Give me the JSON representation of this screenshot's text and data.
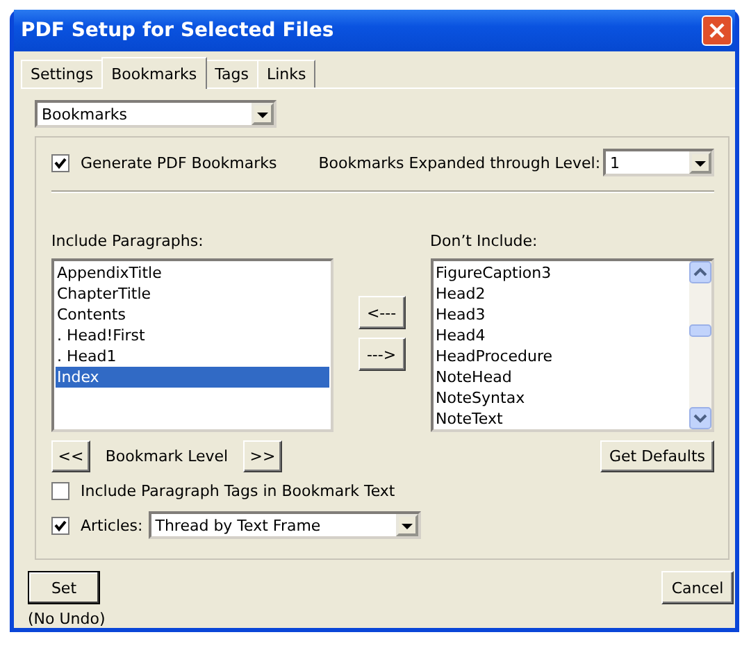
{
  "window": {
    "title": "PDF Setup for Selected Files"
  },
  "tabs": [
    {
      "label": "Settings",
      "selected": false
    },
    {
      "label": "Bookmarks",
      "selected": true
    },
    {
      "label": "Tags",
      "selected": false
    },
    {
      "label": "Links",
      "selected": false
    }
  ],
  "section_dropdown": {
    "value": "Bookmarks"
  },
  "generate_bookmarks": {
    "label": "Generate PDF Bookmarks",
    "checked": true
  },
  "expanded_level": {
    "label": "Bookmarks Expanded through Level:",
    "value": "1"
  },
  "include": {
    "label": "Include Paragraphs:",
    "items": [
      {
        "text": "AppendixTitle",
        "selected": false
      },
      {
        "text": "ChapterTitle",
        "selected": false
      },
      {
        "text": "Contents",
        "selected": false
      },
      {
        "text": ". Head!First",
        "selected": false
      },
      {
        "text": ". Head1",
        "selected": false
      },
      {
        "text": "Index",
        "selected": true
      }
    ]
  },
  "exclude": {
    "label": "Don’t Include:",
    "items": [
      {
        "text": "FigureCaption3",
        "selected": false
      },
      {
        "text": "Head2",
        "selected": false
      },
      {
        "text": "Head3",
        "selected": false
      },
      {
        "text": "Head4",
        "selected": false
      },
      {
        "text": "HeadProcedure",
        "selected": false
      },
      {
        "text": "NoteHead",
        "selected": false
      },
      {
        "text": "NoteSyntax",
        "selected": false
      },
      {
        "text": "NoteText",
        "selected": false
      }
    ]
  },
  "move_buttons": [
    "<---",
    "--->"
  ],
  "level_row": {
    "prev": "<<",
    "label": "Bookmark Level",
    "next": ">>"
  },
  "get_defaults": "Get Defaults",
  "include_tags": {
    "label": "Include Paragraph Tags in Bookmark Text",
    "checked": false
  },
  "articles": {
    "label": "Articles:",
    "checked": true,
    "value": "Thread by Text Frame"
  },
  "set_button": "Set",
  "set_note": "(No Undo)",
  "cancel_button": "Cancel"
}
